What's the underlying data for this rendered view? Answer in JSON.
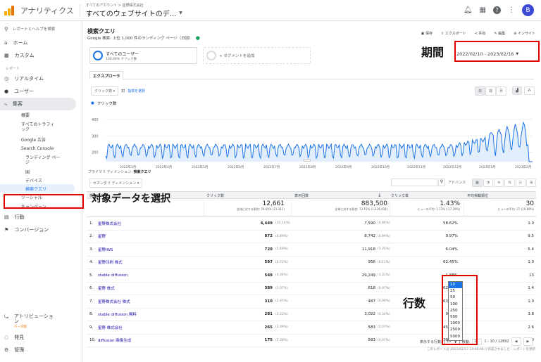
{
  "topbar": {
    "app_name": "アナリティクス",
    "crumb": "すべてのアカウント > 星野株式会社",
    "property": "すべてのウェブサイトのデ...",
    "avatar": "B"
  },
  "sidebar": {
    "search_placeholder": "レポートとヘルプを検索",
    "home": "ホーム",
    "custom": "カスタム",
    "section": "レポート",
    "realtime": "リアルタイム",
    "user": "ユーザー",
    "acquisition": "集客",
    "overview": "概要",
    "all_traffic": "すべてのトラフィ\nック",
    "google_ads": "Google 広告",
    "search_console": "Search Console",
    "landing": "ランディング ペー\nジ",
    "country": "国",
    "device": "デバイス",
    "queries": "検索クエリ",
    "social": "ソーシャル",
    "campaign": "キャンペーン",
    "behavior": "行動",
    "conversion": "コンバージョン",
    "attribution": "アトリビューショ\nン",
    "beta": "ベータ版",
    "discover": "発見",
    "admin": "管理"
  },
  "main": {
    "title": "検索クエリ",
    "subtitle": "Google 検索: 上位 1,000 件のランディング ページ（日別）",
    "toolbar": [
      "保存",
      "エクスポート",
      "共有",
      "編集",
      "インサイト"
    ],
    "segment_all": "すべてのユーザー",
    "segment_all_sub": "100.00% クリック数",
    "segment_add": "+ セグメントを追加",
    "date_range": "2022/02/10 - 2023/02/16",
    "tab_explorer": "エクスプローラ",
    "metric_select": "クリック数",
    "metric_vs": "対",
    "metric_select2": "指標を選択",
    "time_buttons": [
      "日",
      "週",
      "月"
    ],
    "legend_clicks": "クリック数",
    "y_ticks": [
      "400",
      "300",
      "200"
    ],
    "x_ticks": [
      "2022年3月",
      "2022年4月",
      "2022年5月",
      "2022年6月",
      "2022年7月",
      "2022年8月",
      "2022年9月",
      "2022年10月",
      "2022年11月",
      "2022年12月",
      "2023年1月",
      "2023年2月"
    ],
    "primary_dim": "プライマリ ディメンション:",
    "primary_dim_value": "検索クエリ",
    "secondary_dim": "セカンダリ ディメンション",
    "advanced": "アドバンス",
    "columns": [
      "検索クエリ",
      "クリック数",
      "表示回数",
      "クリック率",
      "平均掲載順位"
    ],
    "totals": {
      "clicks": "12,661",
      "clicks_sub": "全体に対する割合: 59.69% (21,211)",
      "impressions": "883,500",
      "impressions_sub": "全体に対する割合: 72.15% (1,224,458)",
      "ctr": "1.43%",
      "ctr_sub": "ビューの平均: 1.73% (-17.28%)",
      "pos": "30",
      "pos_sub": "ビューの平均: 27 (10.89%)"
    },
    "rows": [
      [
        "1.",
        "星野株式会社",
        "4,449",
        "(35.14%)",
        "7,590",
        "(0.86%)",
        "58.62%",
        "1.0"
      ],
      [
        "2.",
        "星野",
        "872",
        "(6.89%)",
        "8,742",
        "(0.99%)",
        "9.97%",
        "9.5"
      ],
      [
        "3.",
        "星野IWS",
        "720",
        "(5.69%)",
        "11,918",
        "(1.35%)",
        "6.04%",
        "5.4"
      ],
      [
        "4.",
        "星野印刷 株式",
        "597",
        "(4.72%)",
        "956",
        "(0.11%)",
        "62.45%",
        "1.0"
      ],
      [
        "5.",
        "stable diffusion",
        "549",
        "(4.34%)",
        "29,249",
        "(3.31%)",
        "1.88%",
        "13"
      ],
      [
        "6.",
        "星野 株式",
        "389",
        "(3.07%)",
        "618",
        "(0.07%)",
        "62.95%",
        "1.4"
      ],
      [
        "7.",
        "星野株式会社 株式",
        "310",
        "(2.45%)",
        "487",
        "(0.06%)",
        "63.66%",
        "1.0"
      ],
      [
        "8.",
        "stable diffusion 無料",
        "281",
        "(2.22%)",
        "3,022",
        "(0.34%)",
        "9.30%",
        "3.8"
      ],
      [
        "9.",
        "星野 株式会社",
        "265",
        "(2.09%)",
        "583",
        "(0.07%)",
        "45.45%",
        "2.6"
      ],
      [
        "10.",
        "diffusion 画像生成",
        "175",
        "(1.38%)",
        "583",
        "(0.07%)",
        "30.02%",
        "1.0"
      ]
    ],
    "rows_label": "表示する行数:",
    "rows_value": "10",
    "goto_label": "移動:",
    "goto_value": "1",
    "range_text": "1 - 10 / 12892",
    "footer_note": "このレポートは 2023/02/17 14:00:00 に作成されました - レポートを更新",
    "dropdown_options": [
      "10",
      "25",
      "50",
      "100",
      "250",
      "500",
      "1000",
      "2500",
      "5000"
    ],
    "annotations": {
      "period": "期間",
      "target": "対象データを選択",
      "rows": "行数"
    }
  }
}
